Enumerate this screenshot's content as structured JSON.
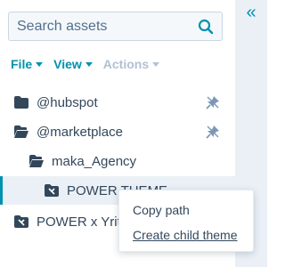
{
  "search": {
    "placeholder": "Search assets"
  },
  "menu": {
    "file": "File",
    "view": "View",
    "actions": "Actions"
  },
  "tree": [
    {
      "label": "@hubspot",
      "icon": "folder-closed-icon",
      "pinned": true
    },
    {
      "label": "@marketplace",
      "icon": "folder-open-icon",
      "pinned": true
    },
    {
      "label": "maka_Agency",
      "icon": "folder-open-icon",
      "pinned": false
    },
    {
      "label": "POWER THEME",
      "icon": "theme-folder-icon",
      "pinned": false,
      "selected": true
    },
    {
      "label": "POWER x Yritys",
      "icon": "theme-folder-icon",
      "pinned": false
    }
  ],
  "context_menu": {
    "copy_path": "Copy path",
    "create_child_theme": "Create child theme"
  },
  "colors": {
    "accent": "#0091ae",
    "text": "#33475b",
    "panel": "#eaf0f6"
  }
}
